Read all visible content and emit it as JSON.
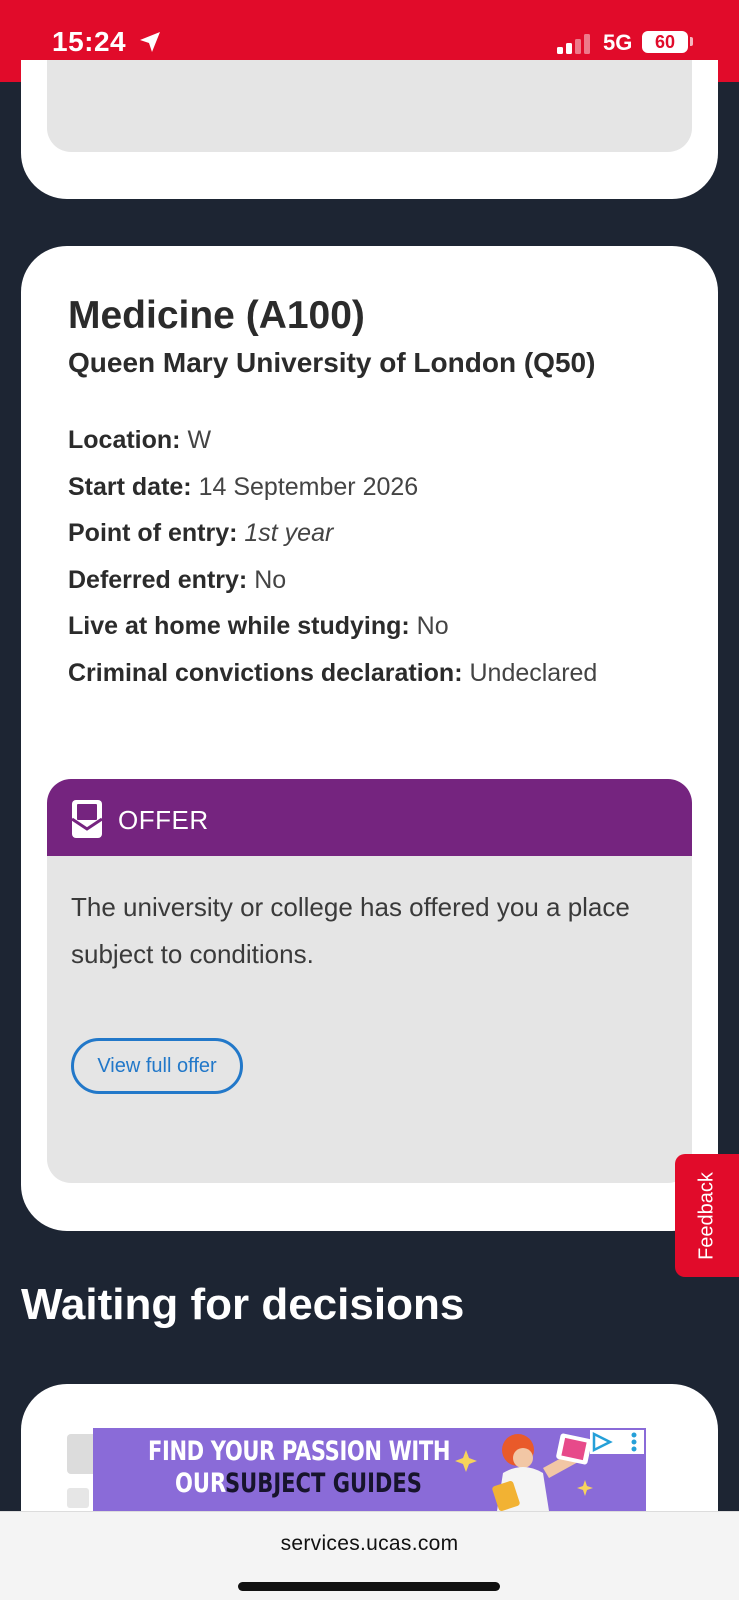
{
  "status_bar": {
    "time": "15:24",
    "network": "5G",
    "battery": "60"
  },
  "course": {
    "title": "Medicine (A100)",
    "university": "Queen Mary University of London (Q50)",
    "details": [
      {
        "label": "Location:",
        "value": "W"
      },
      {
        "label": "Start date:",
        "value": "14 September 2026"
      },
      {
        "label": "Point of entry:",
        "value": "1st year"
      },
      {
        "label": "Deferred entry:",
        "value": "No"
      },
      {
        "label": "Live at home while studying:",
        "value": "No"
      },
      {
        "label": "Criminal convictions declaration:",
        "value": "Undeclared"
      }
    ],
    "offer": {
      "label": "OFFER",
      "text": "The university or college has offered you a place subject to conditions.",
      "button": "View full offer"
    }
  },
  "feedback_label": "Feedback",
  "section_heading": "Waiting for decisions",
  "ad": {
    "line1": "FIND YOUR PASSION WITH",
    "line2_plain": "OUR",
    "line2_highlight": "SUBJECT GUIDES"
  },
  "browser": {
    "url": "services.ucas.com"
  },
  "colors": {
    "brand_red": "#e10b2a",
    "offer_purple": "#75247f",
    "link_blue": "#2278c9",
    "page_bg": "#1d2533"
  }
}
